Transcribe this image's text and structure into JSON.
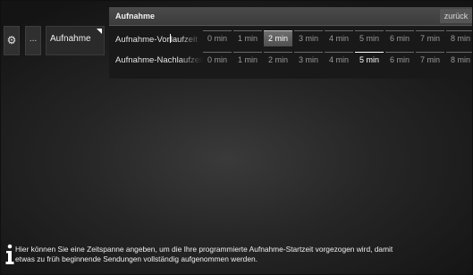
{
  "sidebar": {
    "settings_icon": "gear-icon",
    "settings_glyph": "⚙",
    "more_label": "...",
    "active_item_label": "Aufnahme"
  },
  "panel": {
    "title": "Aufnahme",
    "back_label": "zurück",
    "rows": [
      {
        "label_before_cursor": "Aufnahme-Vor",
        "label_after_cursor": "laufzeit",
        "options": [
          "0 min",
          "1 min",
          "2 min",
          "3 min",
          "4 min",
          "5 min",
          "6 min",
          "7 min",
          "8 min"
        ],
        "selected_value": "2 min"
      },
      {
        "label": "Aufnahme-Nachlaufzeit",
        "options": [
          "0 min",
          "1 min",
          "2 min",
          "3 min",
          "4 min",
          "5 min",
          "6 min",
          "7 min",
          "8 min"
        ],
        "selected_value": "5 min"
      }
    ]
  },
  "footer": {
    "info_icon": "info-icon",
    "help_line1": "Hier können Sie eine Zeitspanne angeben, um die Ihre programmierte Aufnahme-Startzeit vorgezogen wird, damit",
    "help_line2": "etwas zu früh beginnende Sendungen vollständig aufgenommen werden."
  },
  "colors": {
    "background_center": "#3a3a3a",
    "background_edge": "#141414",
    "panel_header": "#4a4a4a",
    "panel_body": "#191919",
    "option_inactive_text": "#9a9a9a",
    "option_focus_bg": "#6e6e6e"
  }
}
